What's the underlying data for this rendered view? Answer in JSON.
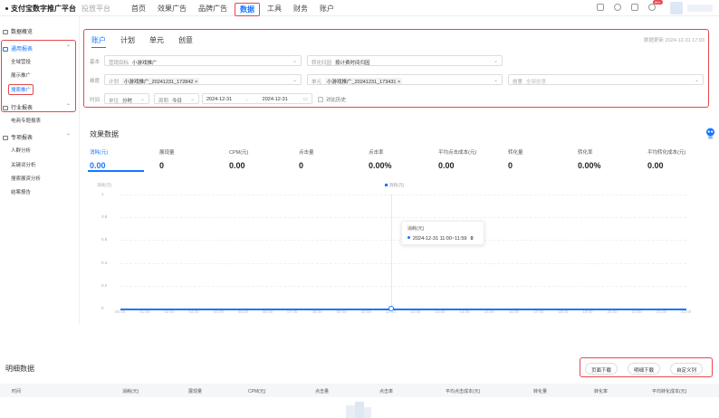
{
  "app": {
    "brand": "支付宝数字推广平台",
    "sub_platform": "投放平台",
    "notification_badge": "99+"
  },
  "nav": [
    "首页",
    "效果广告",
    "品牌广告",
    "数据",
    "工具",
    "财务",
    "账户"
  ],
  "sidebar": {
    "groups": [
      {
        "label": "数据概览",
        "icon": "overview-icon",
        "items": []
      },
      {
        "label": "通用报表",
        "icon": "report-icon",
        "items": [
          "全域营投",
          "展示推广",
          "搜索推广"
        ]
      },
      {
        "label": "行业报表",
        "icon": "industry-icon",
        "items": [
          "电商专题报表"
        ]
      },
      {
        "label": "专项报表",
        "icon": "special-icon",
        "items": [
          "人群分析",
          "关键词分析",
          "搜索展资分析",
          "结案报告"
        ]
      }
    ],
    "selected_item": "搜索推广"
  },
  "filter": {
    "tabs": [
      "账户",
      "计划",
      "单元",
      "创意"
    ],
    "active_tab": "账户",
    "updated": "数据更新 2024-12-31 17:03",
    "row1": {
      "label": "基本",
      "goal_label": "营销目标",
      "goal_value": "小游戏推广",
      "convert_label": "转化归因",
      "convert_value": "按计费时间归因"
    },
    "row2": {
      "label": "维度",
      "plan_label": "计划",
      "plan_value": "小游戏推广_20241231_172842",
      "unit_label": "单元",
      "unit_value": "小游戏推广_20241231_173431",
      "creative_label": "创意",
      "creative_placeholder": "全部创意"
    },
    "row3": {
      "label": "时间",
      "unit_label": "单位",
      "unit_value": "分时",
      "period_label": "周期",
      "period_value": "今日",
      "date_start": "2024-12-31",
      "date_sep": "→",
      "date_end": "2024-12-31",
      "compare_label": "对比历史"
    }
  },
  "effect": {
    "title": "效果数据",
    "metrics": [
      {
        "label": "消耗(元)",
        "value": "0.00"
      },
      {
        "label": "展现量",
        "value": "0"
      },
      {
        "label": "CPM(元)",
        "value": "0.00"
      },
      {
        "label": "点击量",
        "value": "0"
      },
      {
        "label": "点击率",
        "value": "0.00%"
      },
      {
        "label": "平均点击成本(元)",
        "value": "0.00"
      },
      {
        "label": "转化量",
        "value": "0"
      },
      {
        "label": "转化率",
        "value": "0.00%"
      },
      {
        "label": "平均转化成本(元)",
        "value": "0.00"
      }
    ],
    "active_metric": 0
  },
  "chart_data": {
    "type": "line",
    "ylabel": "消耗(元)",
    "ylim": [
      0,
      1
    ],
    "yticks": [
      "1",
      "0.8",
      "0.6",
      "0.4",
      "0.2",
      "0"
    ],
    "legend": [
      "消耗(元)"
    ],
    "x": [
      "00:00",
      "01:00",
      "02:00",
      "03:00",
      "04:00",
      "05:00",
      "06:00",
      "07:00",
      "08:00",
      "09:00",
      "10:00",
      "11:00",
      "12:00",
      "13:00",
      "14:00",
      "15:00",
      "16:00",
      "17:00",
      "18:00",
      "19:00",
      "20:00",
      "21:00",
      "22:00",
      "23:00"
    ],
    "series": [
      {
        "name": "消耗(元)",
        "values": [
          0,
          0,
          0,
          0,
          0,
          0,
          0,
          0,
          0,
          0,
          0,
          0,
          0,
          0,
          0,
          0,
          0,
          0,
          0,
          0,
          0,
          0,
          0,
          0
        ]
      }
    ],
    "tooltip": {
      "title": "消耗(元)",
      "time": "2024-12-31 11:00~11:59",
      "value": "0"
    },
    "grid": true,
    "color": "#1677ff"
  },
  "detail": {
    "title": "明细数据",
    "buttons": [
      "页面下载",
      "明细下载",
      "自定义列"
    ],
    "columns": [
      "时间",
      "消耗(元)",
      "展现量",
      "CPM(元)",
      "点击量",
      "点击率",
      "平均点击成本(元)",
      "转化量",
      "转化率",
      "平均转化成本(元)"
    ]
  }
}
